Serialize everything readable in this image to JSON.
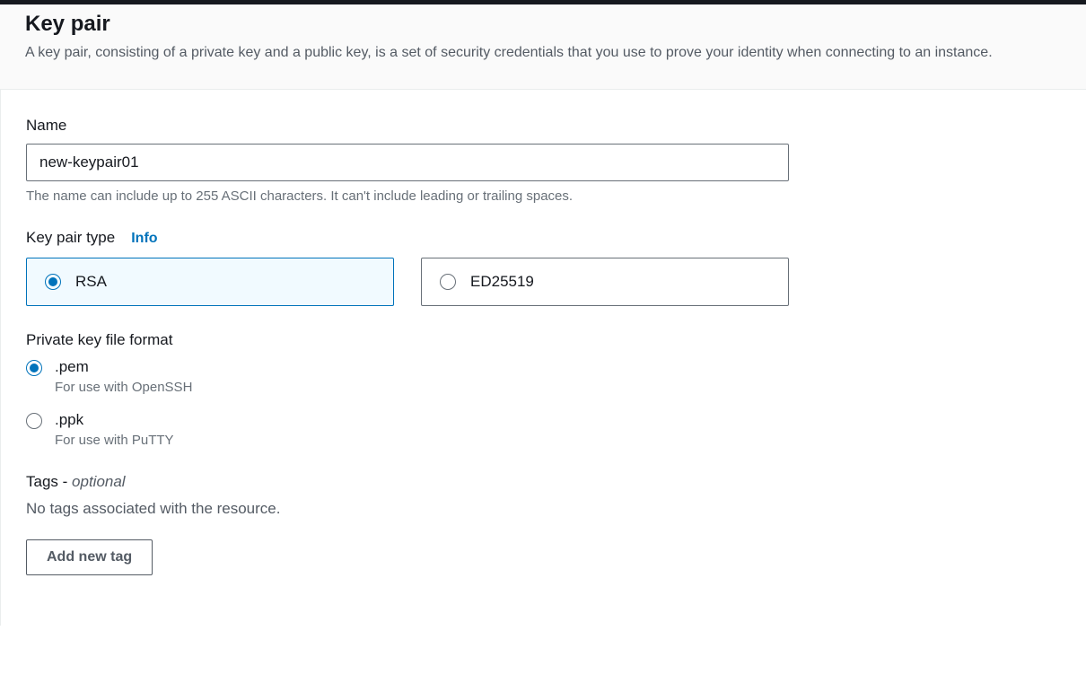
{
  "header": {
    "title": "Key pair",
    "description": "A key pair, consisting of a private key and a public key, is a set of security credentials that you use to prove your identity when connecting to an instance."
  },
  "name_field": {
    "label": "Name",
    "value": "new-keypair01",
    "helper": "The name can include up to 255 ASCII characters. It can't include leading or trailing spaces."
  },
  "type_field": {
    "label": "Key pair type",
    "info_link": "Info",
    "options": [
      {
        "label": "RSA",
        "selected": true
      },
      {
        "label": "ED25519",
        "selected": false
      }
    ]
  },
  "format_field": {
    "label": "Private key file format",
    "options": [
      {
        "label": ".pem",
        "description": "For use with OpenSSH",
        "selected": true
      },
      {
        "label": ".ppk",
        "description": "For use with PuTTY",
        "selected": false
      }
    ]
  },
  "tags": {
    "label_prefix": "Tags - ",
    "label_optional": "optional",
    "empty_text": "No tags associated with the resource.",
    "add_button": "Add new tag"
  }
}
